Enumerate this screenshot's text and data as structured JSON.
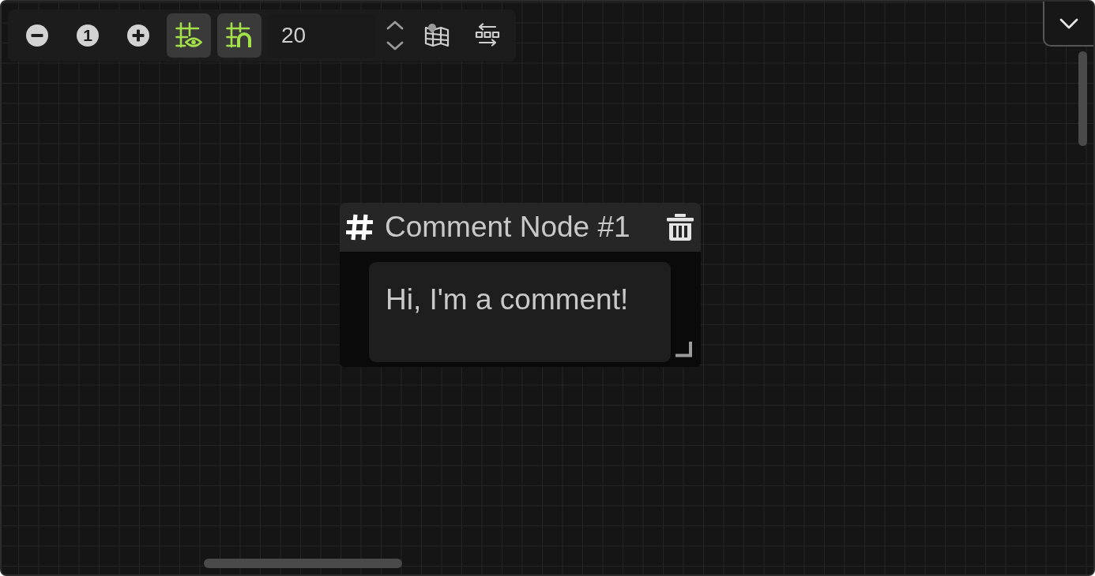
{
  "toolbar": {
    "zoom_reset_label": "1",
    "show_grid": {
      "on": true
    },
    "snap_to_grid": {
      "on": true
    },
    "grid_size": {
      "value": "20"
    }
  },
  "node": {
    "title": "Comment Node #1",
    "comment": "Hi, I'm a comment!"
  }
}
